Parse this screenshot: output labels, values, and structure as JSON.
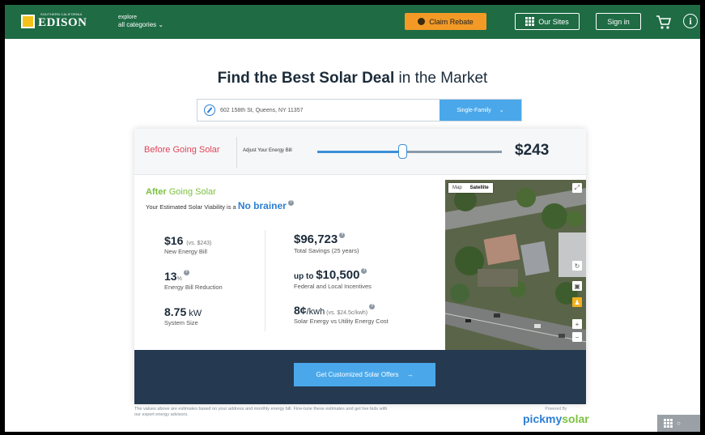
{
  "header": {
    "logo_small": "SOUTHERN CALIFORNIA",
    "logo_name": "EDISON",
    "explore_top": "explore",
    "explore_bottom": "all categories",
    "claim_label": "Claim Rebate",
    "our_sites_label": "Our Sites",
    "sign_in_label": "Sign in",
    "info_glyph": "i"
  },
  "headline": {
    "bold": "Find the Best Solar Deal",
    "rest": " in the Market"
  },
  "address": {
    "value": "602 158th St, Queens, NY 11357",
    "home_type": "Single-Family"
  },
  "before": {
    "label": "Before Going Solar",
    "adjust_label": "Adjust Your Energy Bill",
    "bill": "$243",
    "slider_level": 0.46
  },
  "after": {
    "label_bold": "After",
    "label_rest": " Going Solar",
    "viability_text": "Your Estimated Solar Viability is a ",
    "viability_value": "No brainer"
  },
  "stats": {
    "new_bill": {
      "value": "$16",
      "sub": "(vs. $243)",
      "label": "New Energy Bill"
    },
    "reduction": {
      "value": "13",
      "unit": "%",
      "label": "Energy Bill Reduction"
    },
    "system": {
      "value": "8.75",
      "unit": " kW",
      "label": "System Size"
    },
    "savings": {
      "value": "$96,723",
      "label": "Total Savings (25 years)"
    },
    "incentives": {
      "prefix": "up to ",
      "value": "$10,500",
      "label": "Federal and Local Incentives"
    },
    "rate": {
      "value": "8¢",
      "unit": "/kwh",
      "sub": " (vs. $24.5c/kwh)",
      "label": "Solar Energy vs Utility Energy Cost"
    }
  },
  "map": {
    "tab_map": "Map",
    "tab_satellite": "Satellite"
  },
  "cta_label": "Get Customized Solar Offers",
  "disclaimer": "The values above are estimates based on your address and monthly energy bill. Fine-tune these estimates and get live bids with our expert energy advisors.",
  "powered": {
    "by": "Powered By",
    "brand_a": "pickmy",
    "brand_b": "solar"
  },
  "colors": {
    "header_green": "#1e6b44",
    "claim_orange": "#f39a26",
    "accent_blue": "#4aa8ea",
    "before_red": "#e0465a",
    "after_green": "#7cc23e",
    "band_navy": "#253a50"
  }
}
